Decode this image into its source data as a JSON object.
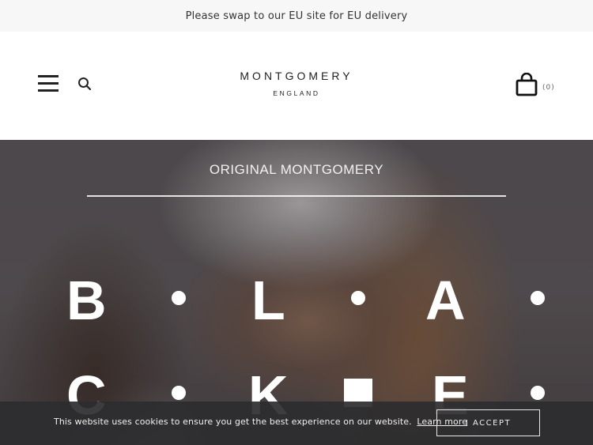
{
  "announcement": {
    "text": "Please swap to our EU site for EU delivery"
  },
  "header": {
    "logo_main": "MONTGOMERY",
    "logo_sub": "ENGLAND",
    "cart_count": "(0)",
    "icons": {
      "menu": "hamburger-menu-icon",
      "search": "search-icon",
      "cart": "shopping-bag-icon"
    }
  },
  "hero": {
    "subtitle": "ORIGINAL MONTGOMERY",
    "letters": [
      "B",
      "L",
      "A",
      "C",
      "K",
      "E"
    ]
  },
  "cookie": {
    "message": "This website uses cookies to ensure you get the best experience on our website.",
    "link_label": "Learn more",
    "accept_label": "I ACCEPT"
  },
  "colors": {
    "text_dark": "#222222",
    "announcement_bg": "#f7f7f7",
    "cookie_bg": "#2d2d2f"
  }
}
